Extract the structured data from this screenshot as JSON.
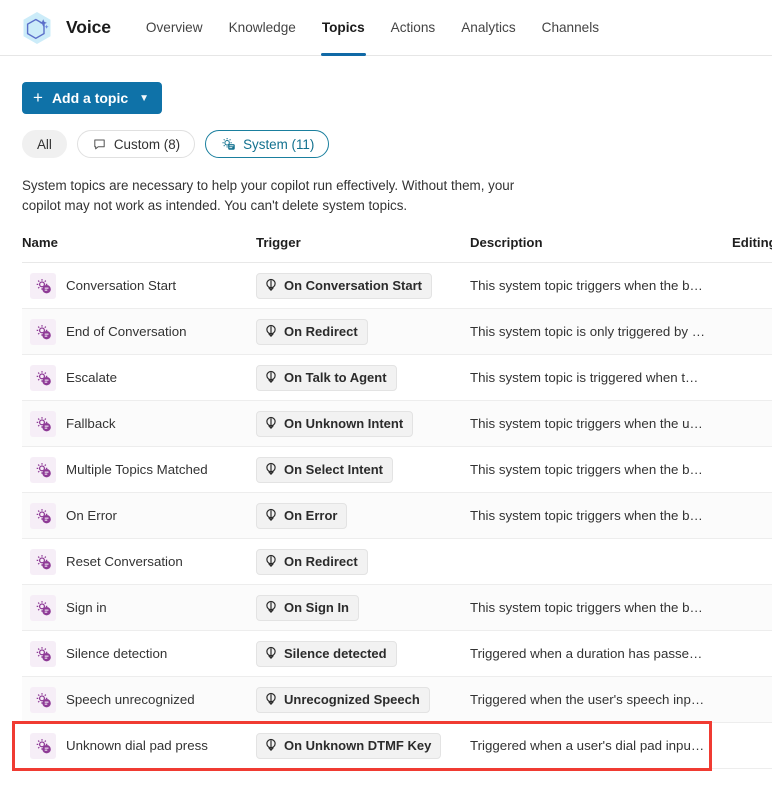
{
  "header": {
    "logo_icon": "copilot-hexagon-icon",
    "brand": "Voice",
    "nav": [
      {
        "label": "Overview",
        "active": false
      },
      {
        "label": "Knowledge",
        "active": false
      },
      {
        "label": "Topics",
        "active": true
      },
      {
        "label": "Actions",
        "active": false
      },
      {
        "label": "Analytics",
        "active": false
      },
      {
        "label": "Channels",
        "active": false
      }
    ]
  },
  "toolbar": {
    "add_topic_label": "Add a topic",
    "add_icon": "plus-icon",
    "chevron_icon": "chevron-down-icon"
  },
  "filters": [
    {
      "label": "All",
      "icon": null,
      "state": "plain"
    },
    {
      "label": "Custom (8)",
      "icon": "chat-bubble-icon",
      "state": "outline"
    },
    {
      "label": "System (11)",
      "icon": "gear-chat-icon",
      "state": "selected"
    }
  ],
  "description": "System topics are necessary to help your copilot run effectively. Without them, your copilot may not work as intended. You can't delete system topics.",
  "table": {
    "columns": [
      "Name",
      "Trigger",
      "Description",
      "Editing"
    ],
    "rows": [
      {
        "icon": "system-topic-icon",
        "name": "Conversation Start",
        "trigger": "On Conversation Start",
        "trigger_icon": "trigger-icon",
        "description": "This system topic triggers when the b…",
        "editing": ""
      },
      {
        "icon": "system-topic-icon",
        "name": "End of Conversation",
        "trigger": "On Redirect",
        "trigger_icon": "trigger-icon",
        "description": "This system topic is only triggered by …",
        "editing": ""
      },
      {
        "icon": "system-topic-icon",
        "name": "Escalate",
        "trigger": "On Talk to Agent",
        "trigger_icon": "trigger-icon",
        "description": "This system topic is triggered when t…",
        "editing": ""
      },
      {
        "icon": "system-topic-icon",
        "name": "Fallback",
        "trigger": "On Unknown Intent",
        "trigger_icon": "trigger-icon",
        "description": "This system topic triggers when the u…",
        "editing": ""
      },
      {
        "icon": "system-topic-icon",
        "name": "Multiple Topics Matched",
        "trigger": "On Select Intent",
        "trigger_icon": "trigger-icon",
        "description": "This system topic triggers when the b…",
        "editing": ""
      },
      {
        "icon": "system-topic-icon",
        "name": "On Error",
        "trigger": "On Error",
        "trigger_icon": "trigger-icon",
        "description": "This system topic triggers when the b…",
        "editing": ""
      },
      {
        "icon": "system-topic-icon",
        "name": "Reset Conversation",
        "trigger": "On Redirect",
        "trigger_icon": "trigger-icon",
        "description": "",
        "editing": ""
      },
      {
        "icon": "system-topic-icon",
        "name": "Sign in",
        "trigger": "On Sign In",
        "trigger_icon": "trigger-icon",
        "description": "This system topic triggers when the b…",
        "editing": ""
      },
      {
        "icon": "system-topic-icon",
        "name": "Silence detection",
        "trigger": "Silence detected",
        "trigger_icon": "trigger-icon",
        "description": "Triggered when a duration has passe…",
        "editing": ""
      },
      {
        "icon": "system-topic-icon",
        "name": "Speech unrecognized",
        "trigger": "Unrecognized Speech",
        "trigger_icon": "trigger-icon",
        "description": "Triggered when the user's speech inp…",
        "editing": ""
      },
      {
        "icon": "system-topic-icon",
        "name": "Unknown dial pad press",
        "trigger": "On Unknown DTMF Key",
        "trigger_icon": "trigger-icon",
        "description": "Triggered when a user's dial pad inpu…",
        "editing": ""
      }
    ]
  },
  "annotation": {
    "highlight_row_index": 10,
    "color": "#f03b32"
  },
  "colors": {
    "accent_blue": "#0f72a8",
    "tab_underline": "#1069a6",
    "selected_pill": "#1a7f9e",
    "topic_icon_purple": "#8e3a96",
    "topic_icon_bg": "#f6eef7",
    "highlight_red": "#f03b32"
  }
}
